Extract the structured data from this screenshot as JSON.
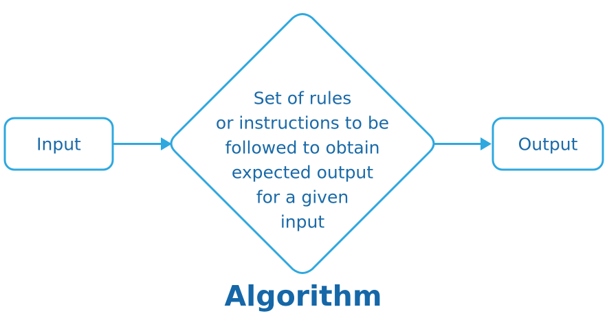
{
  "diagram": {
    "input_label": "Input",
    "output_label": "Output",
    "process_lines": [
      "Set of rules",
      "or instructions to be",
      "followed to obtain",
      "expected output",
      "for a given",
      "input"
    ],
    "title": "Algorithm"
  },
  "colors": {
    "stroke": "#2ea8df",
    "text": "#1a6aa8",
    "title": "#1567a8",
    "background": "#ffffff"
  }
}
